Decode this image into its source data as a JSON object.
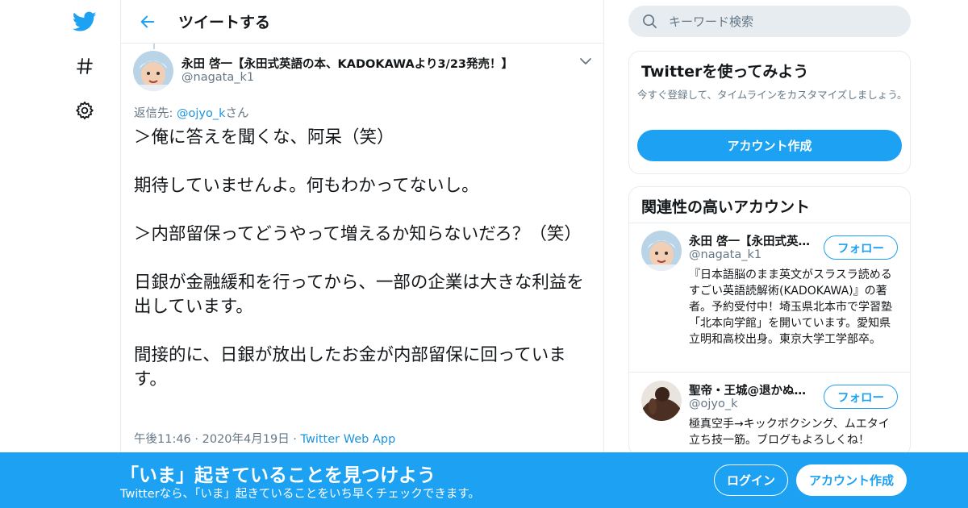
{
  "header": {
    "title": "ツイートする"
  },
  "tweet": {
    "author_name": "永田 啓一【永田式英語の本、KADOKAWAより3/23発売！】",
    "author_handle": "@nagata_k1",
    "reply_prefix": "返信先: ",
    "reply_mention": "@ojyo_k",
    "reply_suffix": "さん",
    "text": "＞俺に答えを聞くな、阿呆（笑）\n\n期待していませんよ。何もわかってないし。\n\n＞内部留保ってどうやって増えるか知らないだろ？（笑）\n\n日銀が金融緩和を行ってから、一部の企業は大きな利益を出しています。\n\n間接的に、日銀が放出したお金が内部留保に回っています。",
    "time": "午後11:46",
    "separator": " · ",
    "date": "2020年4月19日",
    "separator2": " · ",
    "via": "Twitter Web App"
  },
  "search": {
    "placeholder": "キーワード検索"
  },
  "signup_card": {
    "title": "Twitterを使ってみよう",
    "description": "今すぐ登録して、タイムラインをカスタマイズしましょう。",
    "button": "アカウント作成"
  },
  "related_card": {
    "title": "関連性の高いアカウント",
    "accounts": [
      {
        "name": "永田 啓一【永田式英…",
        "handle": "@nagata_k1",
        "follow": "フォロー",
        "bio": "『日本語脳のまま英文がスラスラ読めるすごい英語読解術(KADOKAWA)』の著者。予約受付中！埼玉県北本市で学習塾「北本向学館」を開いています。愛知県立明和高校出身。東京大学工学部卒。"
      },
      {
        "name": "聖帝・王城@退かぬ…",
        "handle": "@ojyo_k",
        "follow": "フォロー",
        "bio": "極真空手→キックボクシング、ムエタイ 立ち技一筋。ブログもよろしくね！"
      }
    ]
  },
  "bottom_bar": {
    "title": "「いま」起きていることを見つけよう",
    "subtitle": "Twitterなら、「いま」起きていることをいち早くチェックできます。",
    "login": "ログイン",
    "signup": "アカウント作成"
  },
  "colors": {
    "accent": "#1da1f2",
    "link": "#1b95e0",
    "muted": "#657786",
    "border": "#e6ecf0"
  },
  "icons": {
    "logo": "twitter-bird-icon",
    "explore": "hashtag-icon",
    "settings": "gear-icon",
    "back": "arrow-left-icon",
    "caret": "chevron-down-icon",
    "search": "search-icon"
  }
}
